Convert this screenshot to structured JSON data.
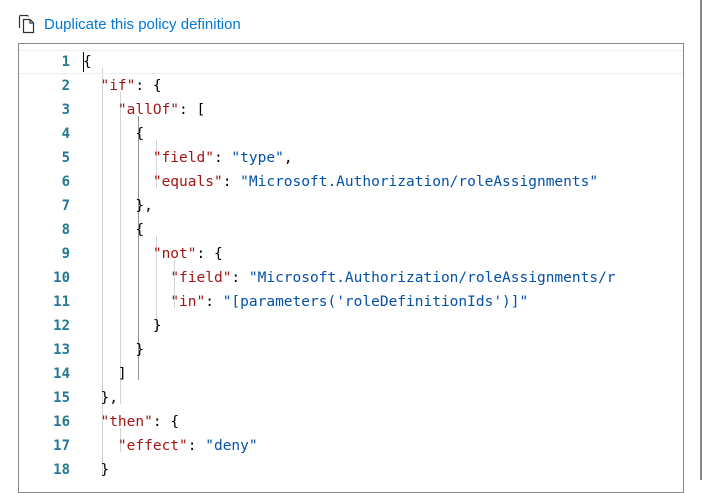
{
  "toolbar": {
    "duplicate_label": "Duplicate this policy definition",
    "duplicate_icon": "copy-icon"
  },
  "editor": {
    "lines": [
      {
        "num": "1",
        "indent": "",
        "tokens": [
          {
            "t": "punc",
            "v": "{"
          }
        ]
      },
      {
        "num": "2",
        "indent": "  ",
        "tokens": [
          {
            "t": "key",
            "v": "\"if\""
          },
          {
            "t": "punc",
            "v": ": {"
          }
        ]
      },
      {
        "num": "3",
        "indent": "    ",
        "tokens": [
          {
            "t": "key",
            "v": "\"allOf\""
          },
          {
            "t": "punc",
            "v": ": ["
          }
        ]
      },
      {
        "num": "4",
        "indent": "      ",
        "tokens": [
          {
            "t": "punc",
            "v": "{"
          }
        ]
      },
      {
        "num": "5",
        "indent": "        ",
        "tokens": [
          {
            "t": "key",
            "v": "\"field\""
          },
          {
            "t": "punc",
            "v": ": "
          },
          {
            "t": "str",
            "v": "\"type\""
          },
          {
            "t": "punc",
            "v": ","
          }
        ]
      },
      {
        "num": "6",
        "indent": "        ",
        "tokens": [
          {
            "t": "key",
            "v": "\"equals\""
          },
          {
            "t": "punc",
            "v": ": "
          },
          {
            "t": "str",
            "v": "\"Microsoft.Authorization/roleAssignments\""
          }
        ]
      },
      {
        "num": "7",
        "indent": "      ",
        "tokens": [
          {
            "t": "punc",
            "v": "},"
          }
        ]
      },
      {
        "num": "8",
        "indent": "      ",
        "tokens": [
          {
            "t": "punc",
            "v": "{"
          }
        ]
      },
      {
        "num": "9",
        "indent": "        ",
        "tokens": [
          {
            "t": "key",
            "v": "\"not\""
          },
          {
            "t": "punc",
            "v": ": {"
          }
        ]
      },
      {
        "num": "10",
        "indent": "          ",
        "tokens": [
          {
            "t": "key",
            "v": "\"field\""
          },
          {
            "t": "punc",
            "v": ": "
          },
          {
            "t": "str",
            "v": "\"Microsoft.Authorization/roleAssignments/r"
          }
        ]
      },
      {
        "num": "11",
        "indent": "          ",
        "tokens": [
          {
            "t": "key",
            "v": "\"in\""
          },
          {
            "t": "punc",
            "v": ": "
          },
          {
            "t": "str",
            "v": "\"[parameters('roleDefinitionIds')]\""
          }
        ]
      },
      {
        "num": "12",
        "indent": "        ",
        "tokens": [
          {
            "t": "punc",
            "v": "}"
          }
        ]
      },
      {
        "num": "13",
        "indent": "      ",
        "tokens": [
          {
            "t": "punc",
            "v": "}"
          }
        ]
      },
      {
        "num": "14",
        "indent": "    ",
        "tokens": [
          {
            "t": "punc",
            "v": "]"
          }
        ]
      },
      {
        "num": "15",
        "indent": "  ",
        "tokens": [
          {
            "t": "punc",
            "v": "},"
          }
        ]
      },
      {
        "num": "16",
        "indent": "  ",
        "tokens": [
          {
            "t": "key",
            "v": "\"then\""
          },
          {
            "t": "punc",
            "v": ": {"
          }
        ]
      },
      {
        "num": "17",
        "indent": "    ",
        "tokens": [
          {
            "t": "key",
            "v": "\"effect\""
          },
          {
            "t": "punc",
            "v": ": "
          },
          {
            "t": "str",
            "v": "\"deny\""
          }
        ]
      },
      {
        "num": "18",
        "indent": "  ",
        "tokens": [
          {
            "t": "punc",
            "v": "}"
          }
        ]
      }
    ]
  },
  "colors": {
    "link": "#0078d4",
    "line_number": "#237893",
    "json_key": "#a31515",
    "json_string": "#0451a5",
    "punctuation": "#000000"
  }
}
